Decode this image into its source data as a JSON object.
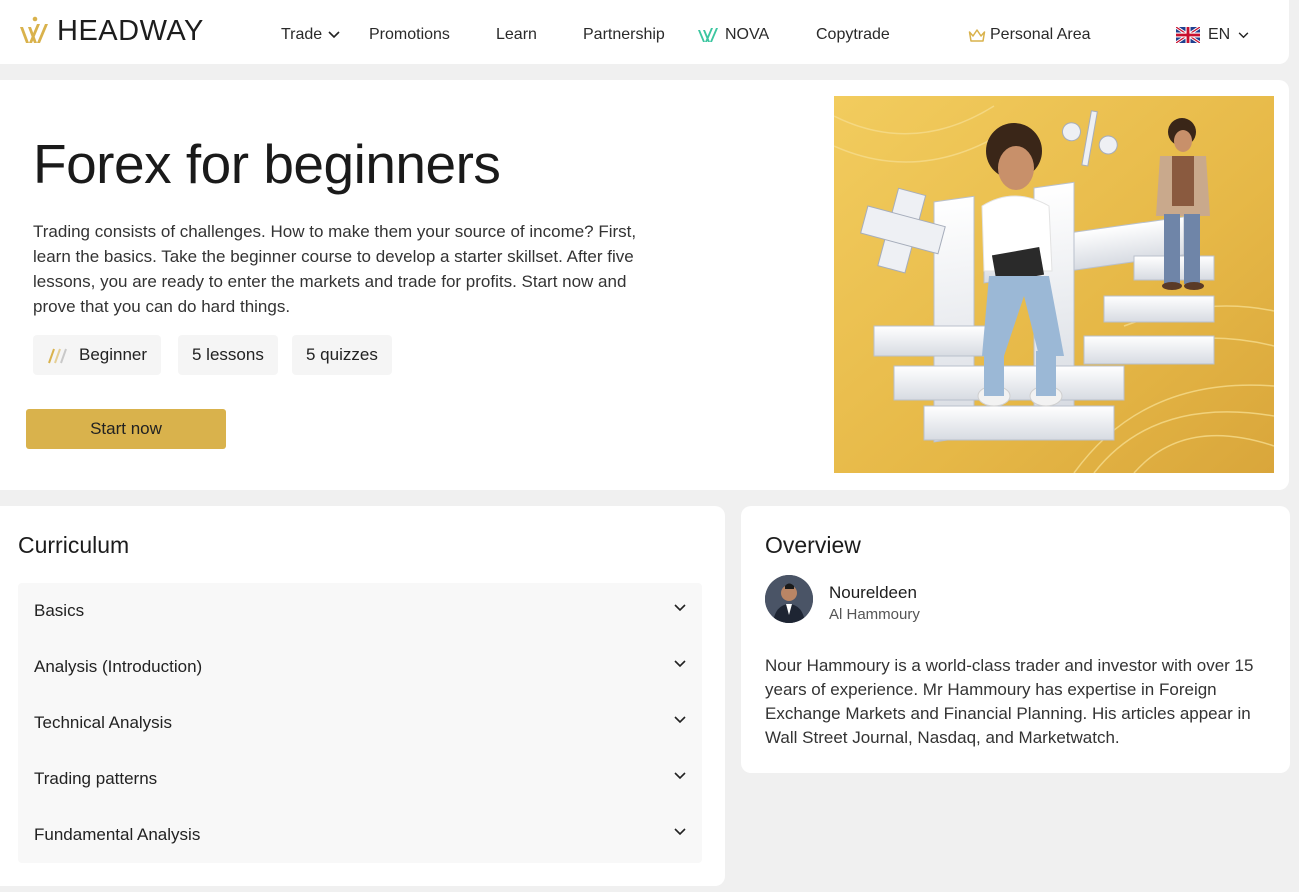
{
  "brand": {
    "name": "HEADWAY",
    "accent": "#d9b24c",
    "nova_color": "#3cc6a0"
  },
  "nav": {
    "items": [
      {
        "label": "Trade",
        "icon": "chevron-down-icon"
      },
      {
        "label": "Promotions"
      },
      {
        "label": "Learn"
      },
      {
        "label": "Partnership"
      },
      {
        "label": "NOVA",
        "icon": "nova-icon"
      },
      {
        "label": "Copytrade"
      },
      {
        "label": "Personal Area",
        "icon": "crown-icon"
      }
    ],
    "language": {
      "label": "EN",
      "icon": "uk-flag-icon"
    }
  },
  "hero": {
    "title": "Forex for beginners",
    "description": "Trading consists of challenges. How to make them your source of income? First, learn the basics. Take the beginner course to develop a starter skillset. After five lessons, you are ready to enter the markets and trade for profits. Start now and prove that you can do hard things.",
    "tags": [
      {
        "label": "Beginner",
        "icon": "level-bars-icon"
      },
      {
        "label": "5 lessons"
      },
      {
        "label": "5 quizzes"
      }
    ],
    "cta": "Start now",
    "image": "hero-illustration"
  },
  "curriculum": {
    "title": "Curriculum",
    "items": [
      {
        "label": "Basics"
      },
      {
        "label": "Analysis (Introduction)"
      },
      {
        "label": "Technical Analysis"
      },
      {
        "label": "Trading patterns"
      },
      {
        "label": "Fundamental Analysis"
      }
    ]
  },
  "overview": {
    "title": "Overview",
    "author_first": "Noureldeen",
    "author_last": "Al Hammoury",
    "description": "Nour Hammoury is a world-class trader and investor with over 15 years of experience. Mr Hammoury has expertise in Foreign Exchange Markets and Financial Planning. His articles appear in Wall Street Journal, Nasdaq, and Marketwatch."
  }
}
